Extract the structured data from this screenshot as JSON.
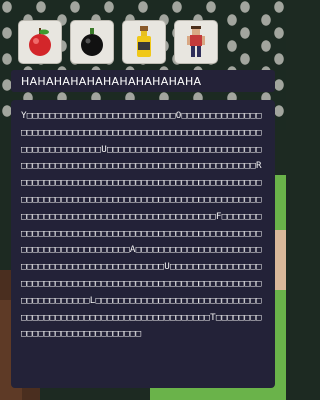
{
  "inventory": {
    "slots": [
      {
        "item": "apple-icon"
      },
      {
        "item": "bomb-icon"
      },
      {
        "item": "bottle-icon"
      },
      {
        "item": "character-icon"
      }
    ]
  },
  "header": {
    "title": "HAHAHAHAHAHAHAHAHAHAHA"
  },
  "dialog": {
    "text": "Y□□□□□□□□□□□□□□□□□□□□□□□□□□O□□□□□□□□□□□□□□□□□□□□□□□□□□□□□□□□□□□□□□□□□□□□□□□□□□□□□□□□□□□□□□□□□□□□□□U□□□□□□□□□□□□□□□□□□□□□□□□□□□□□□□□□□□□□□□□□□□□□□□□□□□□□□□□□□□□□□□□□□□□R□□□□□□□□□□□□□□□□□□□□□□□□□□□□□□□□□□□□□□□□□□□□□□□□□□□□□□□□□□□□□□□□□□□□□□□□□□□□□□□□□□□□□□□□□□□□□□□□□□□□□□□□□□□□□□□□□□□□□□F□□□□□□□□□□□□□□□□□□□□□□□□□□□□□□□□□□□□□□□□□□□□□□□□□□□□□□□□□□□□□□□□□□□□A□□□□□□□□□□□□□□□□□□□□□□□□□□□□□□□□□□□□□□□□□□□□□□□U□□□□□□□□□□□□□□□□□□□□□□□□□□□□□□□□□□□□□□□□□□□□□□□□□□□□□□□□□□□□□□□□□□□□□□L□□□□□□□□□□□□□□□□□□□□□□□□□□□□□□□□□□□□□□□□□□□□□□□□□□□□□□□□□□□□□□T□□□□□□□□□□□□□□□□□□□□□□□□□□□□□"
  },
  "colors": {
    "panel": "#232238",
    "skull_background": "#1c2a22",
    "grass": "#6ab34a"
  }
}
